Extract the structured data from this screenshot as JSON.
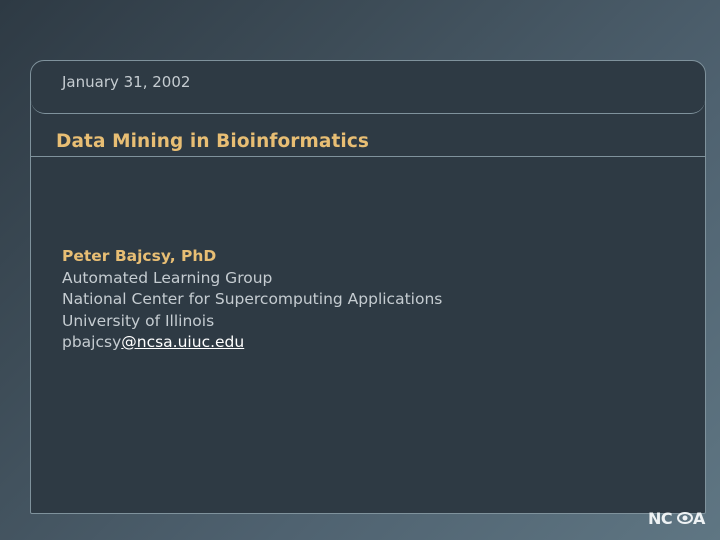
{
  "slide": {
    "date": "January 31, 2002",
    "title": "Data Mining in Bioinformatics",
    "author": {
      "name": "Peter Bajcsy, PhD",
      "group": "Automated Learning Group",
      "center": "National Center for Supercomputing Applications",
      "university": "University of Illinois",
      "email_prefix": "pbajcsy",
      "email_domain": "@ncsa.uiuc.edu"
    }
  },
  "logo": {
    "text": "NCSA",
    "icon": "ncsa-logo-icon"
  },
  "colors": {
    "title": "#e8be74",
    "body_text": "#c5ccd1",
    "panel": "#2e3a44",
    "border": "#7f929c"
  }
}
